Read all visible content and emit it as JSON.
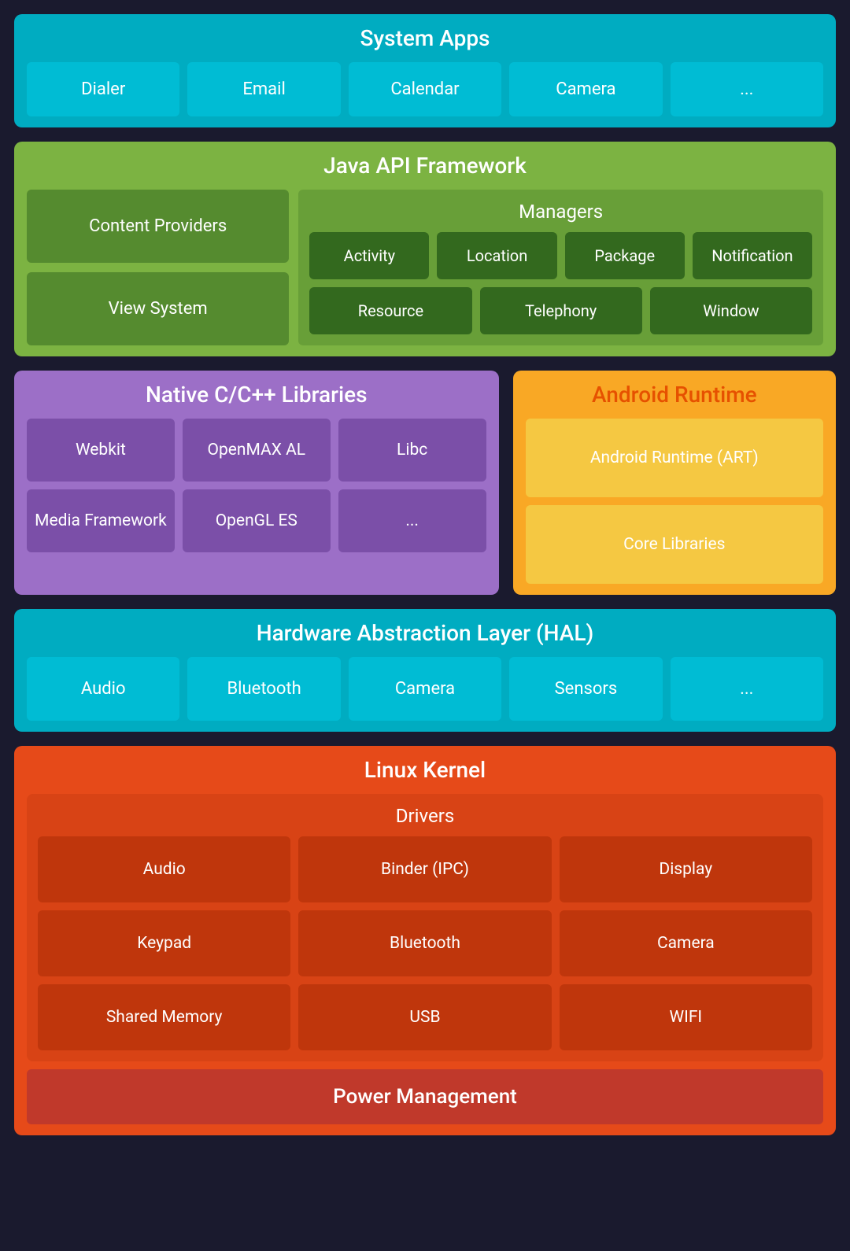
{
  "systemApps": {
    "title": "System Apps",
    "apps": [
      "Dialer",
      "Email",
      "Calendar",
      "Camera",
      "..."
    ]
  },
  "javaApi": {
    "title": "Java API Framework",
    "left": [
      "Content Providers",
      "View System"
    ],
    "managers": {
      "title": "Managers",
      "row1": [
        "Activity",
        "Location",
        "Package",
        "Notification"
      ],
      "row2": [
        "Resource",
        "Telephony",
        "Window"
      ]
    }
  },
  "nativeLibs": {
    "title": "Native C/C++ Libraries",
    "row1": [
      "Webkit",
      "OpenMAX AL",
      "Libc"
    ],
    "row2": [
      "Media Framework",
      "OpenGL ES",
      "..."
    ]
  },
  "androidRuntime": {
    "title": "Android Runtime",
    "items": [
      "Android Runtime (ART)",
      "Core Libraries"
    ]
  },
  "hal": {
    "title": "Hardware Abstraction Layer (HAL)",
    "items": [
      "Audio",
      "Bluetooth",
      "Camera",
      "Sensors",
      "..."
    ]
  },
  "linuxKernel": {
    "title": "Linux Kernel",
    "drivers": {
      "title": "Drivers",
      "row1": [
        "Audio",
        "Binder (IPC)",
        "Display"
      ],
      "row2": [
        "Keypad",
        "Bluetooth",
        "Camera"
      ],
      "row3": [
        "Shared Memory",
        "USB",
        "WIFI"
      ]
    },
    "powerManagement": "Power Management"
  }
}
